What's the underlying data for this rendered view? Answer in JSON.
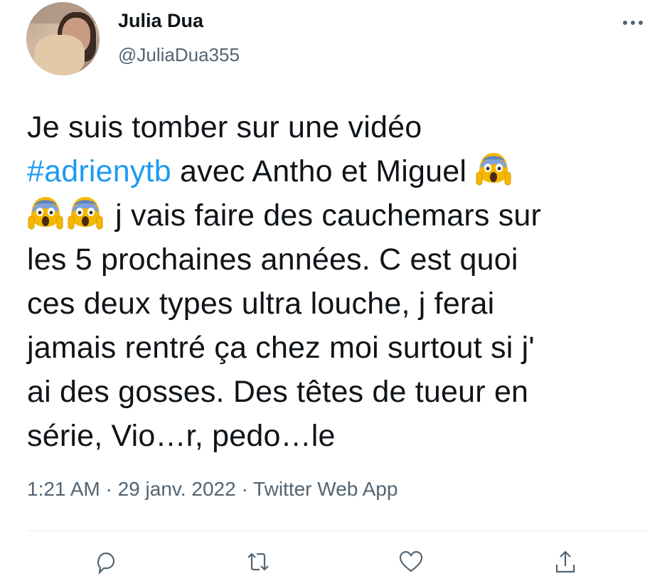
{
  "user": {
    "display_name": "Julia Dua",
    "handle": "@JuliaDua355"
  },
  "tweet": {
    "lines": [
      {
        "parts": [
          {
            "type": "text",
            "value": "Je suis tomber sur une vidéo"
          }
        ]
      },
      {
        "parts": [
          {
            "type": "hashtag",
            "value": "#adrienytb"
          },
          {
            "type": "text",
            "value": " avec Antho et Miguel "
          },
          {
            "type": "emoji",
            "value": "😱"
          }
        ]
      },
      {
        "parts": [
          {
            "type": "emoji",
            "value": "😱"
          },
          {
            "type": "emoji",
            "value": "😱"
          },
          {
            "type": "text",
            "value": " j vais faire des cauchemars sur"
          }
        ]
      },
      {
        "parts": [
          {
            "type": "text",
            "value": "les 5 prochaines années. C est quoi"
          }
        ]
      },
      {
        "parts": [
          {
            "type": "text",
            "value": "ces deux types ultra louche, j ferai"
          }
        ]
      },
      {
        "parts": [
          {
            "type": "text",
            "value": "jamais rentré ça chez moi surtout si j'"
          }
        ]
      },
      {
        "parts": [
          {
            "type": "text",
            "value": "ai des gosses. Des têtes de tueur en"
          }
        ]
      },
      {
        "parts": [
          {
            "type": "text",
            "value": "série, Vio…r, pedo…le"
          }
        ]
      }
    ],
    "meta": "1:21 AM · 29 janv. 2022 · Twitter Web App"
  },
  "icons": {
    "more": "more-horizontal-icon",
    "reply": "reply-icon",
    "retweet": "retweet-icon",
    "like": "heart-icon",
    "share": "share-icon",
    "emoji": "face-screaming-in-fear-icon"
  },
  "colors": {
    "text": "#0f1419",
    "secondary": "#536471",
    "link": "#1d9bf0",
    "divider": "#e6ecf0"
  }
}
